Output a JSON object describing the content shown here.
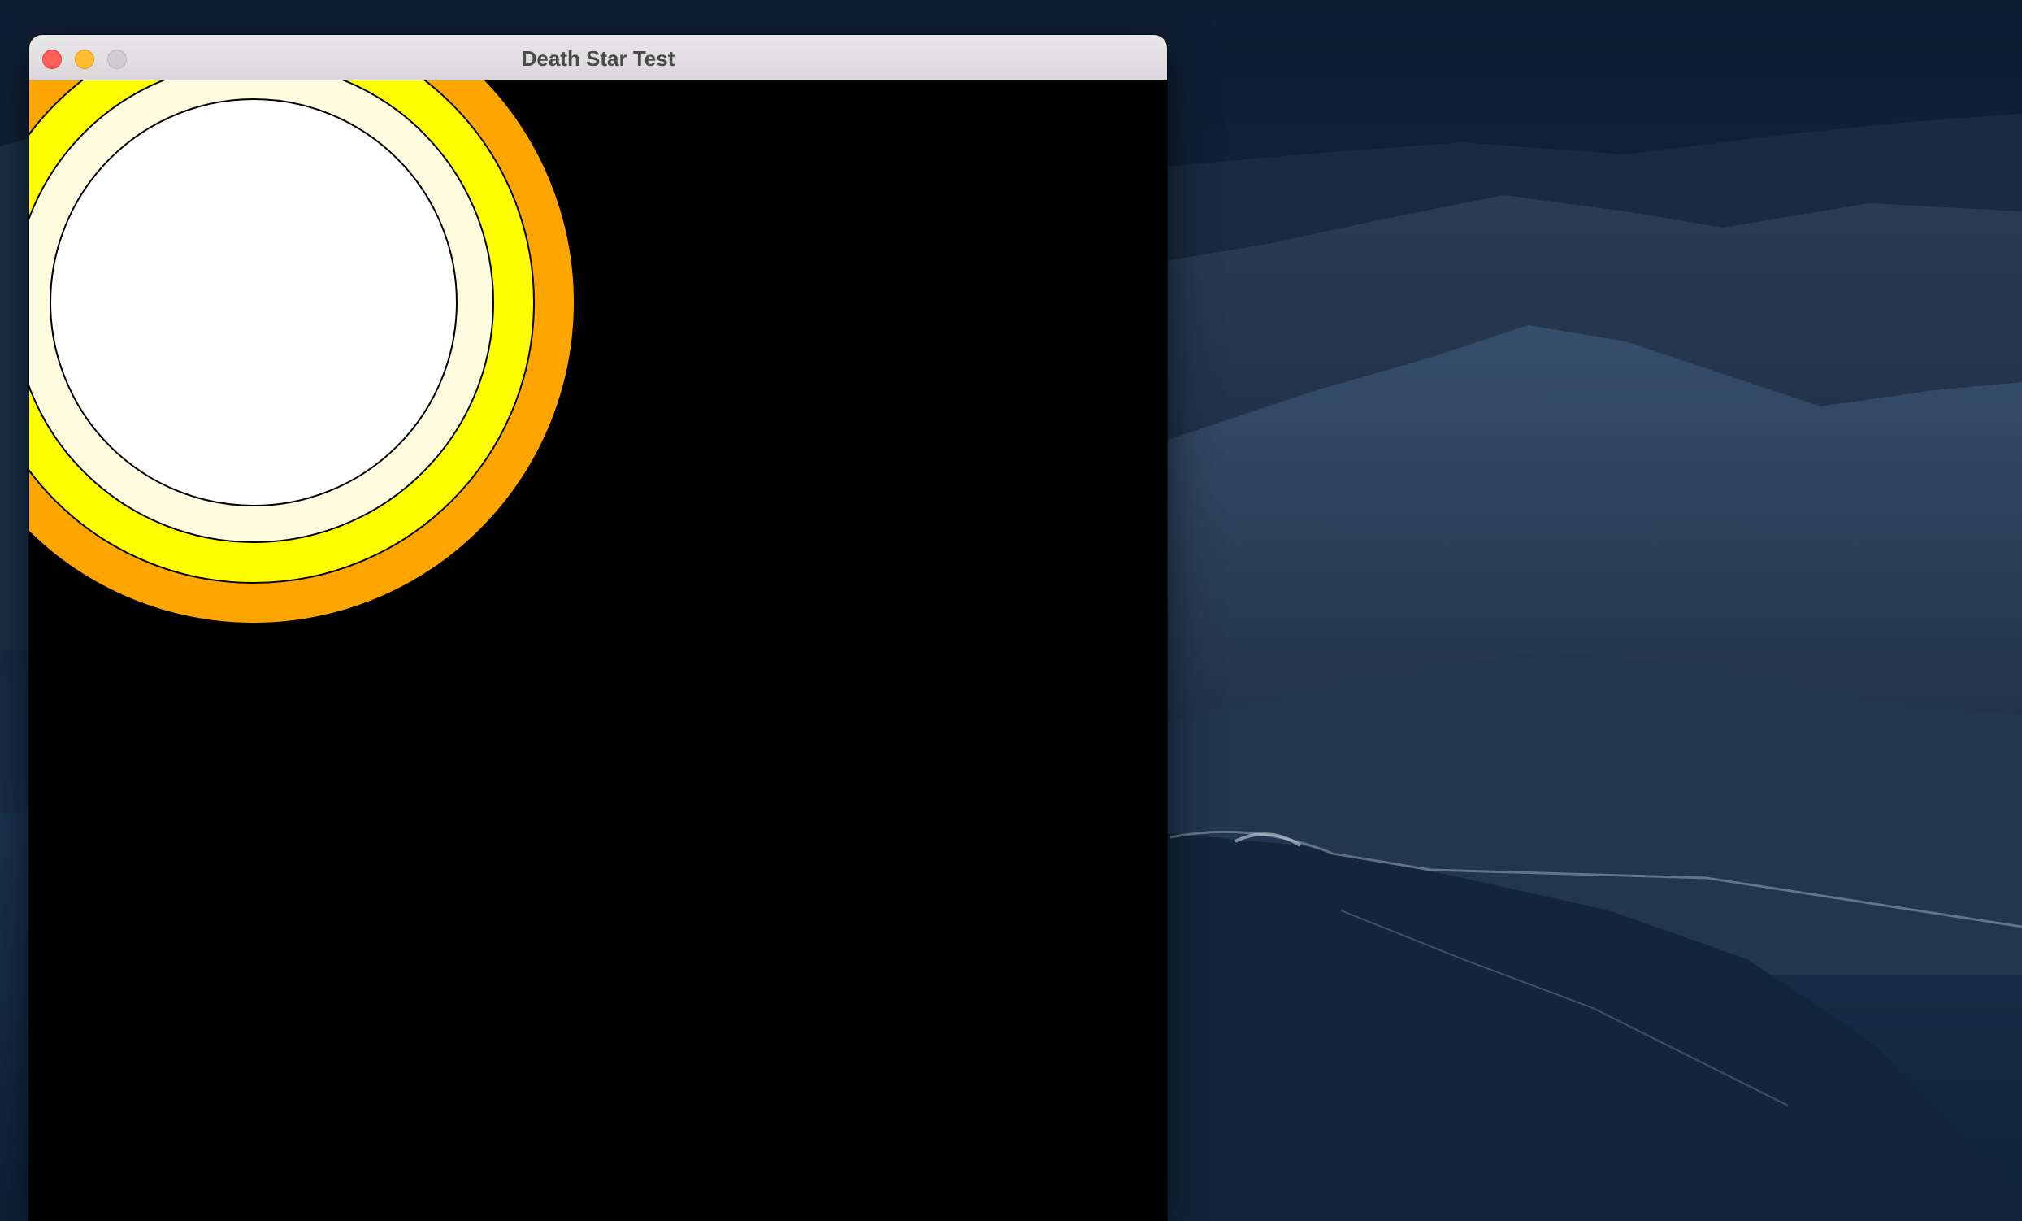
{
  "window": {
    "title": "Death Star Test"
  },
  "title_bar_buttons": {
    "close_icon": "close-icon",
    "minimize_icon": "minimize-icon",
    "zoom_icon": "zoom-icon"
  },
  "canvas": {
    "background_color": "#000000",
    "rings": [
      {
        "name": "outer-ring",
        "fill": "#ffa500"
      },
      {
        "name": "middle-ring",
        "fill": "#ffff00"
      },
      {
        "name": "inner-ring",
        "fill": "#fffce0"
      },
      {
        "name": "core",
        "fill": "#ffffff"
      }
    ],
    "outline_color": "#000000"
  },
  "colors": {
    "close": "#fe5f57",
    "minimize": "#febc2e",
    "zoom_disabled": "#cfcdcf",
    "title_text": "#4a4a4a"
  }
}
